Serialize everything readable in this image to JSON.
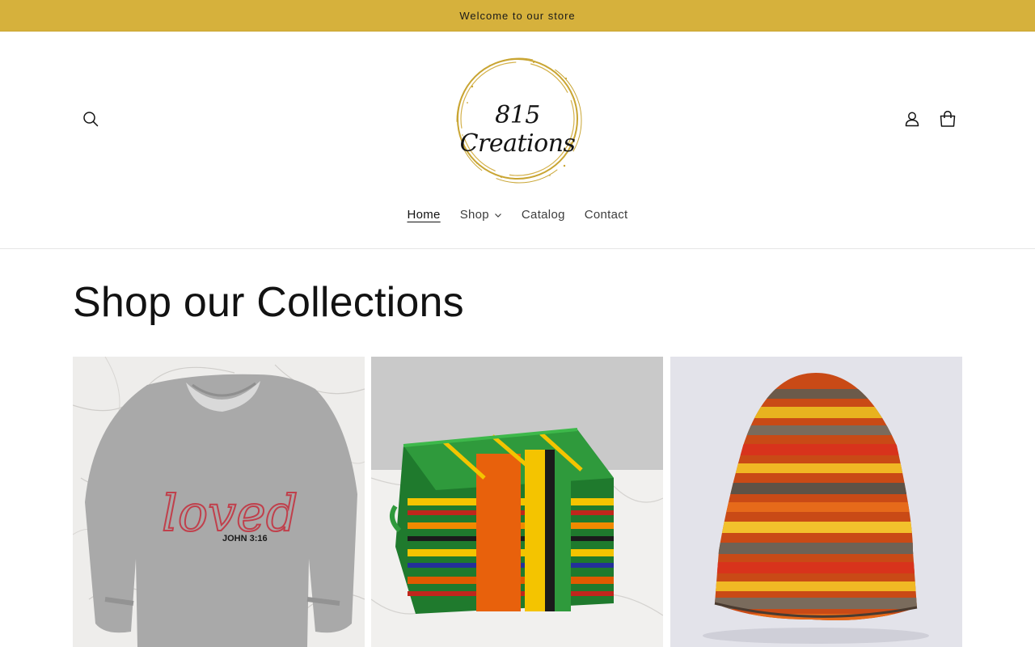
{
  "announcement": {
    "text": "Welcome to our store"
  },
  "header": {
    "logo_text": "815 Creations",
    "icons": {
      "search": "search-icon",
      "account": "account-icon",
      "cart": "cart-icon"
    }
  },
  "nav": {
    "items": [
      {
        "label": "Home",
        "active": true
      },
      {
        "label": "Shop",
        "has_dropdown": true
      },
      {
        "label": "Catalog"
      },
      {
        "label": "Contact"
      }
    ]
  },
  "main": {
    "title": "Shop our Collections",
    "collections": [
      {
        "image": "sweatshirt-loved-john-316",
        "embroidery_text": "loved",
        "verse": "JOHN 3:16"
      },
      {
        "image": "kente-cosmetic-bag"
      },
      {
        "image": "knit-beanie-autumn-stripes"
      }
    ]
  },
  "colors": {
    "announcement_bg": "#d6b13c",
    "logo_gold": "#c9a533",
    "text": "#121212"
  }
}
